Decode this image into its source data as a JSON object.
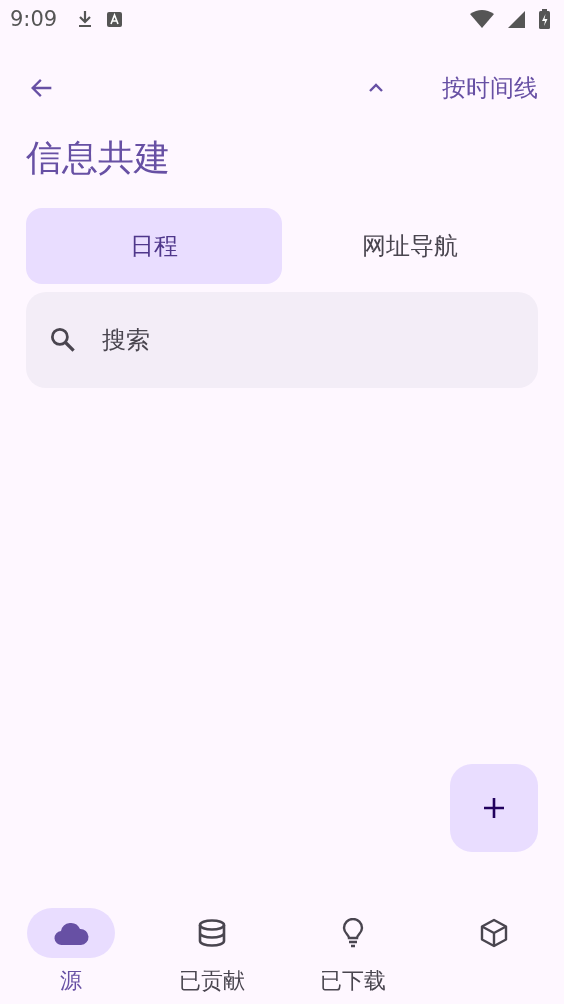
{
  "status_bar": {
    "time": "9:09"
  },
  "top_bar": {
    "action": "按时间线"
  },
  "title": "信息共建",
  "tabs": [
    {
      "label": "日程",
      "selected": true
    },
    {
      "label": "网址导航",
      "selected": false
    }
  ],
  "search": {
    "placeholder": "搜索"
  },
  "nav": [
    {
      "kind": "cloud",
      "label": "源",
      "selected": true
    },
    {
      "kind": "database",
      "label": "已贡献",
      "selected": false
    },
    {
      "kind": "bulb",
      "label": "已下载",
      "selected": false
    },
    {
      "kind": "cube",
      "selected": false
    }
  ]
}
